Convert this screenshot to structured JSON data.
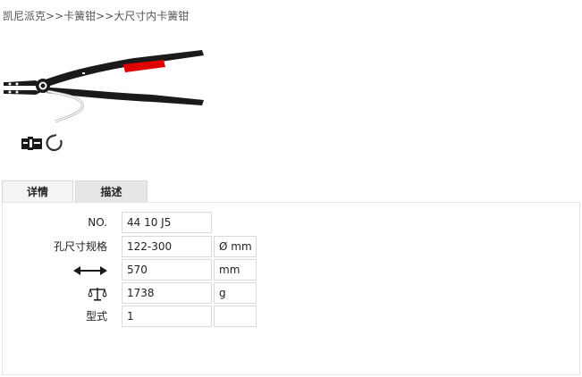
{
  "breadcrumb": {
    "items": [
      "凯尼派克",
      "卡簧钳",
      "大尺寸内卡簧钳"
    ],
    "separator": ">>"
  },
  "product": {
    "image_icon": "circlip-pliers-image",
    "picto_icons": [
      "jaw-type-icon",
      "internal-circlip-icon"
    ]
  },
  "tabs": [
    {
      "label": "详情",
      "active": true
    },
    {
      "label": "描述",
      "active": false
    }
  ],
  "specs": {
    "no": {
      "label": "NO.",
      "value": "44 10 J5",
      "unit": ""
    },
    "bore": {
      "label": "孔尺寸规格",
      "value": "122-300",
      "unit": "Ø mm"
    },
    "length": {
      "label_icon": "length-arrows-icon",
      "value": "570",
      "unit": "mm"
    },
    "weight": {
      "label_icon": "weight-scale-icon",
      "value": "1738",
      "unit": "g"
    },
    "type": {
      "label": "型式",
      "value": "1",
      "unit": ""
    }
  },
  "colors": {
    "handle": "#1a1a1a",
    "grip_red": "#e00000",
    "tab_bg": "#e6e6e6",
    "border": "#d9d9d9"
  }
}
